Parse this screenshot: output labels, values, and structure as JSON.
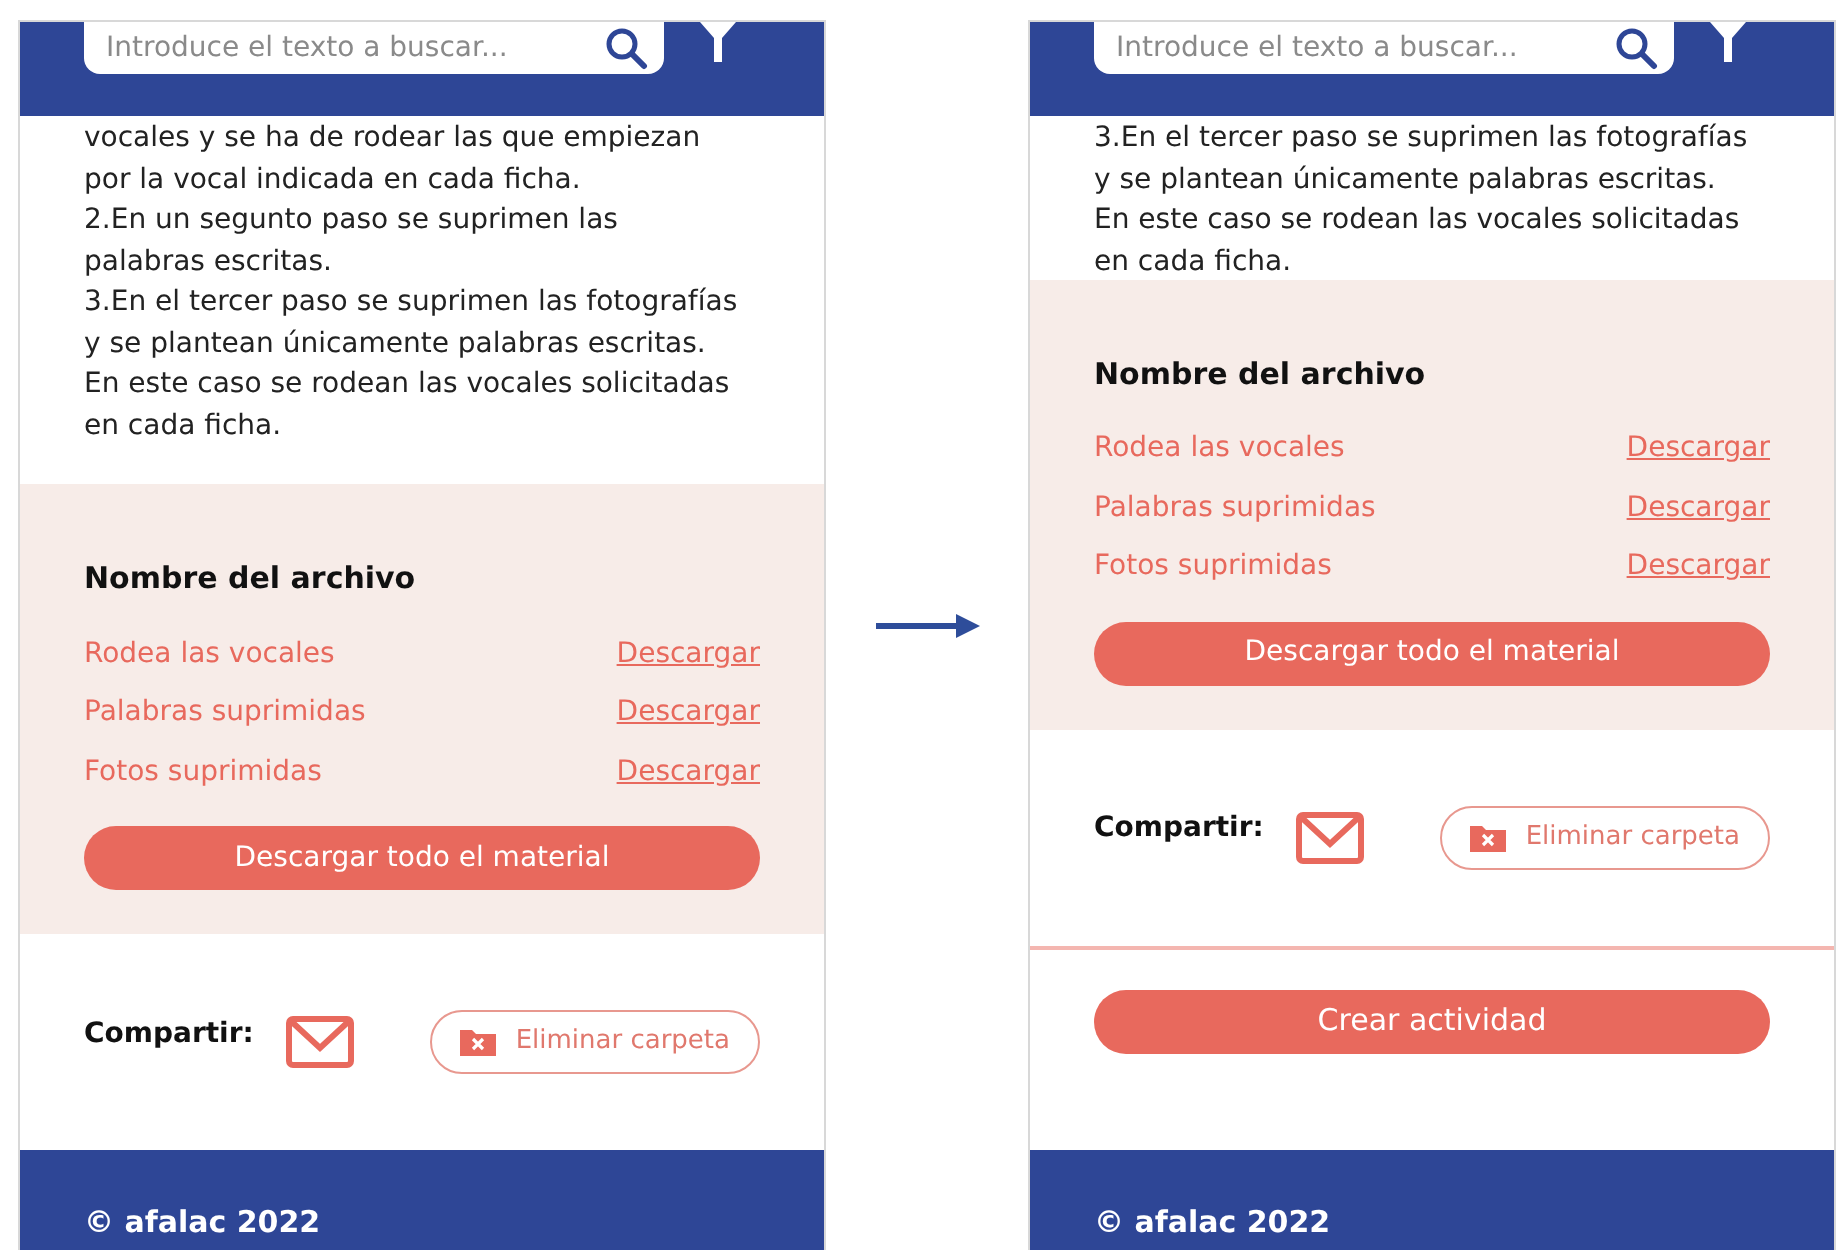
{
  "screens": [
    {
      "search": {
        "placeholder": "Introduce el texto a buscar..."
      },
      "paragraphs": [
        "vocales y se ha de rodear las que empiezan por la vocal indicada en cada ficha.",
        "2.En un segunto paso se suprimen las palabras escritas.",
        "3.En el tercer paso se suprimen las fotografías y se plantean únicamente palabras escritas. En este caso se rodean las vocales solicitadas en cada ficha."
      ],
      "files": {
        "title": "Nombre del archivo",
        "rows": [
          {
            "name": "Rodea las vocales",
            "action": "Descargar"
          },
          {
            "name": "Palabras suprimidas",
            "action": "Descargar"
          },
          {
            "name": "Fotos suprimidas",
            "action": "Descargar"
          }
        ],
        "download_all": "Descargar todo el material"
      },
      "share": {
        "label": "Compartir:",
        "delete_button": "Eliminar carpeta"
      },
      "footer": "© afalac 2022"
    },
    {
      "search": {
        "placeholder": "Introduce el texto a buscar..."
      },
      "paragraphs": [
        "3.En el tercer paso se suprimen las fotografías y se plantean únicamente palabras escritas. En este caso se rodean las vocales solicitadas en cada ficha."
      ],
      "files": {
        "title": "Nombre del archivo",
        "rows": [
          {
            "name": "Rodea las vocales",
            "action": "Descargar"
          },
          {
            "name": "Palabras suprimidas",
            "action": "Descargar"
          },
          {
            "name": "Fotos suprimidas",
            "action": "Descargar"
          }
        ],
        "download_all": "Descargar todo el material"
      },
      "share": {
        "label": "Compartir:",
        "delete_button": "Eliminar carpeta"
      },
      "create_button": "Crear actividad",
      "footer": "© afalac 2022"
    }
  ]
}
